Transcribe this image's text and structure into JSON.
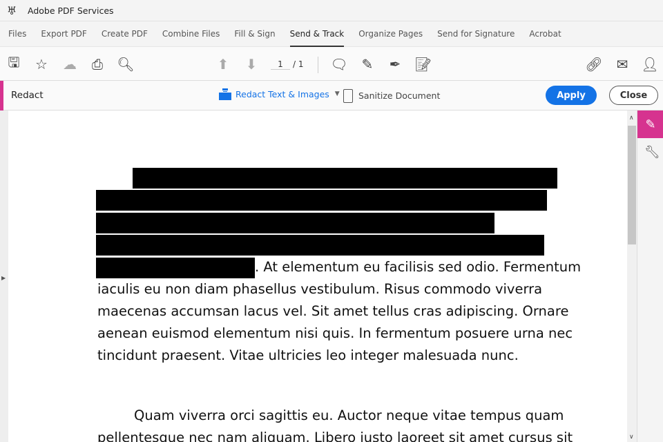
{
  "app": {
    "title": "Adobe PDF Services"
  },
  "menu": {
    "tabs": [
      {
        "label": "Files"
      },
      {
        "label": "Export PDF"
      },
      {
        "label": "Create PDF"
      },
      {
        "label": "Combine Files"
      },
      {
        "label": "Fill & Sign"
      },
      {
        "label": "Send & Track",
        "active": true
      },
      {
        "label": "Organize Pages"
      },
      {
        "label": "Send for Signature"
      },
      {
        "label": "Acrobat"
      }
    ]
  },
  "toolbar": {
    "current_page": "1",
    "total_pages": "/ 1"
  },
  "redact": {
    "label": "Redact",
    "redact_text_images": "Redact Text & Images",
    "sanitize": "Sanitize Document",
    "apply": "Apply",
    "close": "Close"
  },
  "document": {
    "lines": [
      ". At elementum eu facilisis sed odio. Fermentum",
      "iaculis eu non diam phasellus vestibulum. Risus commodo viverra",
      "maecenas accumsan lacus vel. Sit amet tellus cras adipiscing. Ornare",
      "aenean euismod elementum nisi quis. In fermentum posuere urna nec",
      "tincidunt praesent. Vitae ultricies leo integer malesuada nunc.",
      "Quam viverra orci sagittis eu. Auctor neque vitae tempus quam",
      "pellentesque nec nam aliquam. Libero justo laoreet sit amet cursus sit"
    ]
  }
}
